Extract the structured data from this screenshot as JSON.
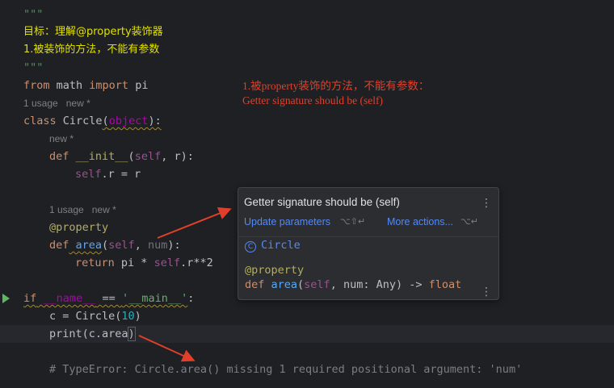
{
  "editor": {
    "docstring": {
      "open_quotes": "\"\"\"",
      "goal": "目标：理解@property装饰器",
      "point1": "1.被装饰的方法，不能有参数",
      "close_quotes": "\"\"\""
    },
    "import_line": {
      "from": "from",
      "module": " math ",
      "import": "import",
      "name": " pi"
    },
    "hint_class": {
      "usage": "1 usage",
      "new": "new *"
    },
    "class_line": {
      "kw": "class",
      "name": " Circle",
      "open": "(",
      "base": "object",
      "close": "):"
    },
    "hint_init": {
      "new": "new *"
    },
    "init_line": {
      "kw": "def",
      "name": " __init__",
      "open": "(",
      "self": "self",
      "rest": ", r):"
    },
    "init_body": {
      "self": "self",
      "rest": ".r = r"
    },
    "hint_area": {
      "usage": "1 usage",
      "new": "new *"
    },
    "decorator": "@property",
    "area_line": {
      "kw": "def",
      "name": " area",
      "open": "(",
      "self": "self",
      "comma": ", ",
      "param": "num",
      "close": "):"
    },
    "return_line": {
      "kw": "return",
      "pre": " pi * ",
      "self": "self",
      "rest": ".r**2"
    },
    "main_line": {
      "kw": "if",
      "name": " __name__",
      "eq": " == ",
      "str": "'__main__'",
      "colon": ":"
    },
    "c_line": {
      "pre": "c = Circle(",
      "num": "10",
      "close": ")"
    },
    "print_line": {
      "fn": "print",
      "open": "(",
      "mid": "c.area",
      "close": ")"
    },
    "comment": "# TypeError: Circle.area() missing 1 required positional argument: 'num'"
  },
  "annotation": {
    "line1": "1.被property装饰的方法，不能有参数：",
    "line2": "Getter signature should be (self)"
  },
  "popup": {
    "title": "Getter signature should be (self)",
    "update_label": "Update parameters",
    "update_shortcut": "⌥⇧↵",
    "more_label": "More actions...",
    "more_shortcut": "⌥↵",
    "class_icon": "C",
    "class_name": "Circle",
    "decorator": "@property",
    "sig": {
      "kw": "def",
      "name": " area",
      "open": "(",
      "self": "self",
      "rest": ", num: Any) -> ",
      "ret": "float"
    },
    "menu_icon": "⋮"
  },
  "colors": {
    "background": "#1f2023",
    "annotation": "#e0402b",
    "link": "#548af7",
    "run": "#5fb85f"
  },
  "icons": [
    "run-icon",
    "class-icon",
    "more-menu-icon",
    "arrow-annotation"
  ]
}
